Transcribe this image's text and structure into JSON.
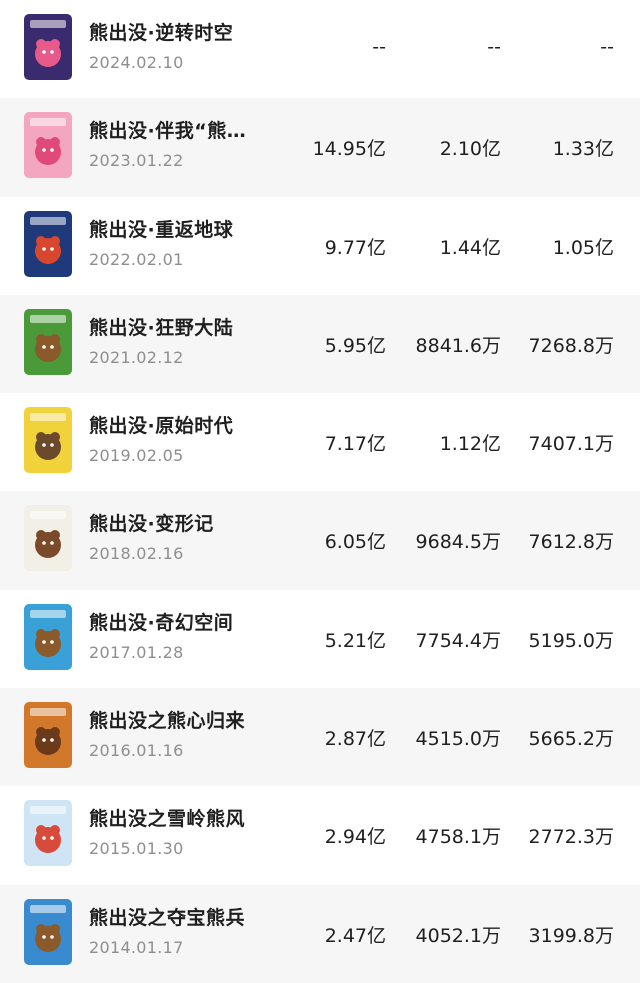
{
  "movies": [
    {
      "title": "熊出没·逆转时空",
      "date": "2024.02.10",
      "v1": "--",
      "v2": "--",
      "v3": "--",
      "poster_color": "#3a2a6e",
      "poster_accent": "#e85a8a"
    },
    {
      "title": "熊出没·伴我“熊…",
      "date": "2023.01.22",
      "v1": "14.95亿",
      "v2": "2.10亿",
      "v3": "1.33亿",
      "poster_color": "#f4a6c0",
      "poster_accent": "#e04a7a"
    },
    {
      "title": "熊出没·重返地球",
      "date": "2022.02.01",
      "v1": "9.77亿",
      "v2": "1.44亿",
      "v3": "1.05亿",
      "poster_color": "#1e3a7a",
      "poster_accent": "#d8462e"
    },
    {
      "title": "熊出没·狂野大陆",
      "date": "2021.02.12",
      "v1": "5.95亿",
      "v2": "8841.6万",
      "v3": "7268.8万",
      "poster_color": "#4a9a3a",
      "poster_accent": "#8a5a2a"
    },
    {
      "title": "熊出没·原始时代",
      "date": "2019.02.05",
      "v1": "7.17亿",
      "v2": "1.12亿",
      "v3": "7407.1万",
      "poster_color": "#f2d23a",
      "poster_accent": "#6a4a2a"
    },
    {
      "title": "熊出没·变形记",
      "date": "2018.02.16",
      "v1": "6.05亿",
      "v2": "9684.5万",
      "v3": "7612.8万",
      "poster_color": "#f2efe6",
      "poster_accent": "#7a4a2a"
    },
    {
      "title": "熊出没·奇幻空间",
      "date": "2017.01.28",
      "v1": "5.21亿",
      "v2": "7754.4万",
      "v3": "5195.0万",
      "poster_color": "#3aa0d8",
      "poster_accent": "#8a5a2a"
    },
    {
      "title": "熊出没之熊心归来",
      "date": "2016.01.16",
      "v1": "2.87亿",
      "v2": "4515.0万",
      "v3": "5665.2万",
      "poster_color": "#d2782a",
      "poster_accent": "#6a3a1a"
    },
    {
      "title": "熊出没之雪岭熊风",
      "date": "2015.01.30",
      "v1": "2.94亿",
      "v2": "4758.1万",
      "v3": "2772.3万",
      "poster_color": "#cfe4f4",
      "poster_accent": "#d84a3a"
    },
    {
      "title": "熊出没之夺宝熊兵",
      "date": "2014.01.17",
      "v1": "2.47亿",
      "v2": "4052.1万",
      "v3": "3199.8万",
      "poster_color": "#3a8ad0",
      "poster_accent": "#8a5a2a"
    }
  ]
}
